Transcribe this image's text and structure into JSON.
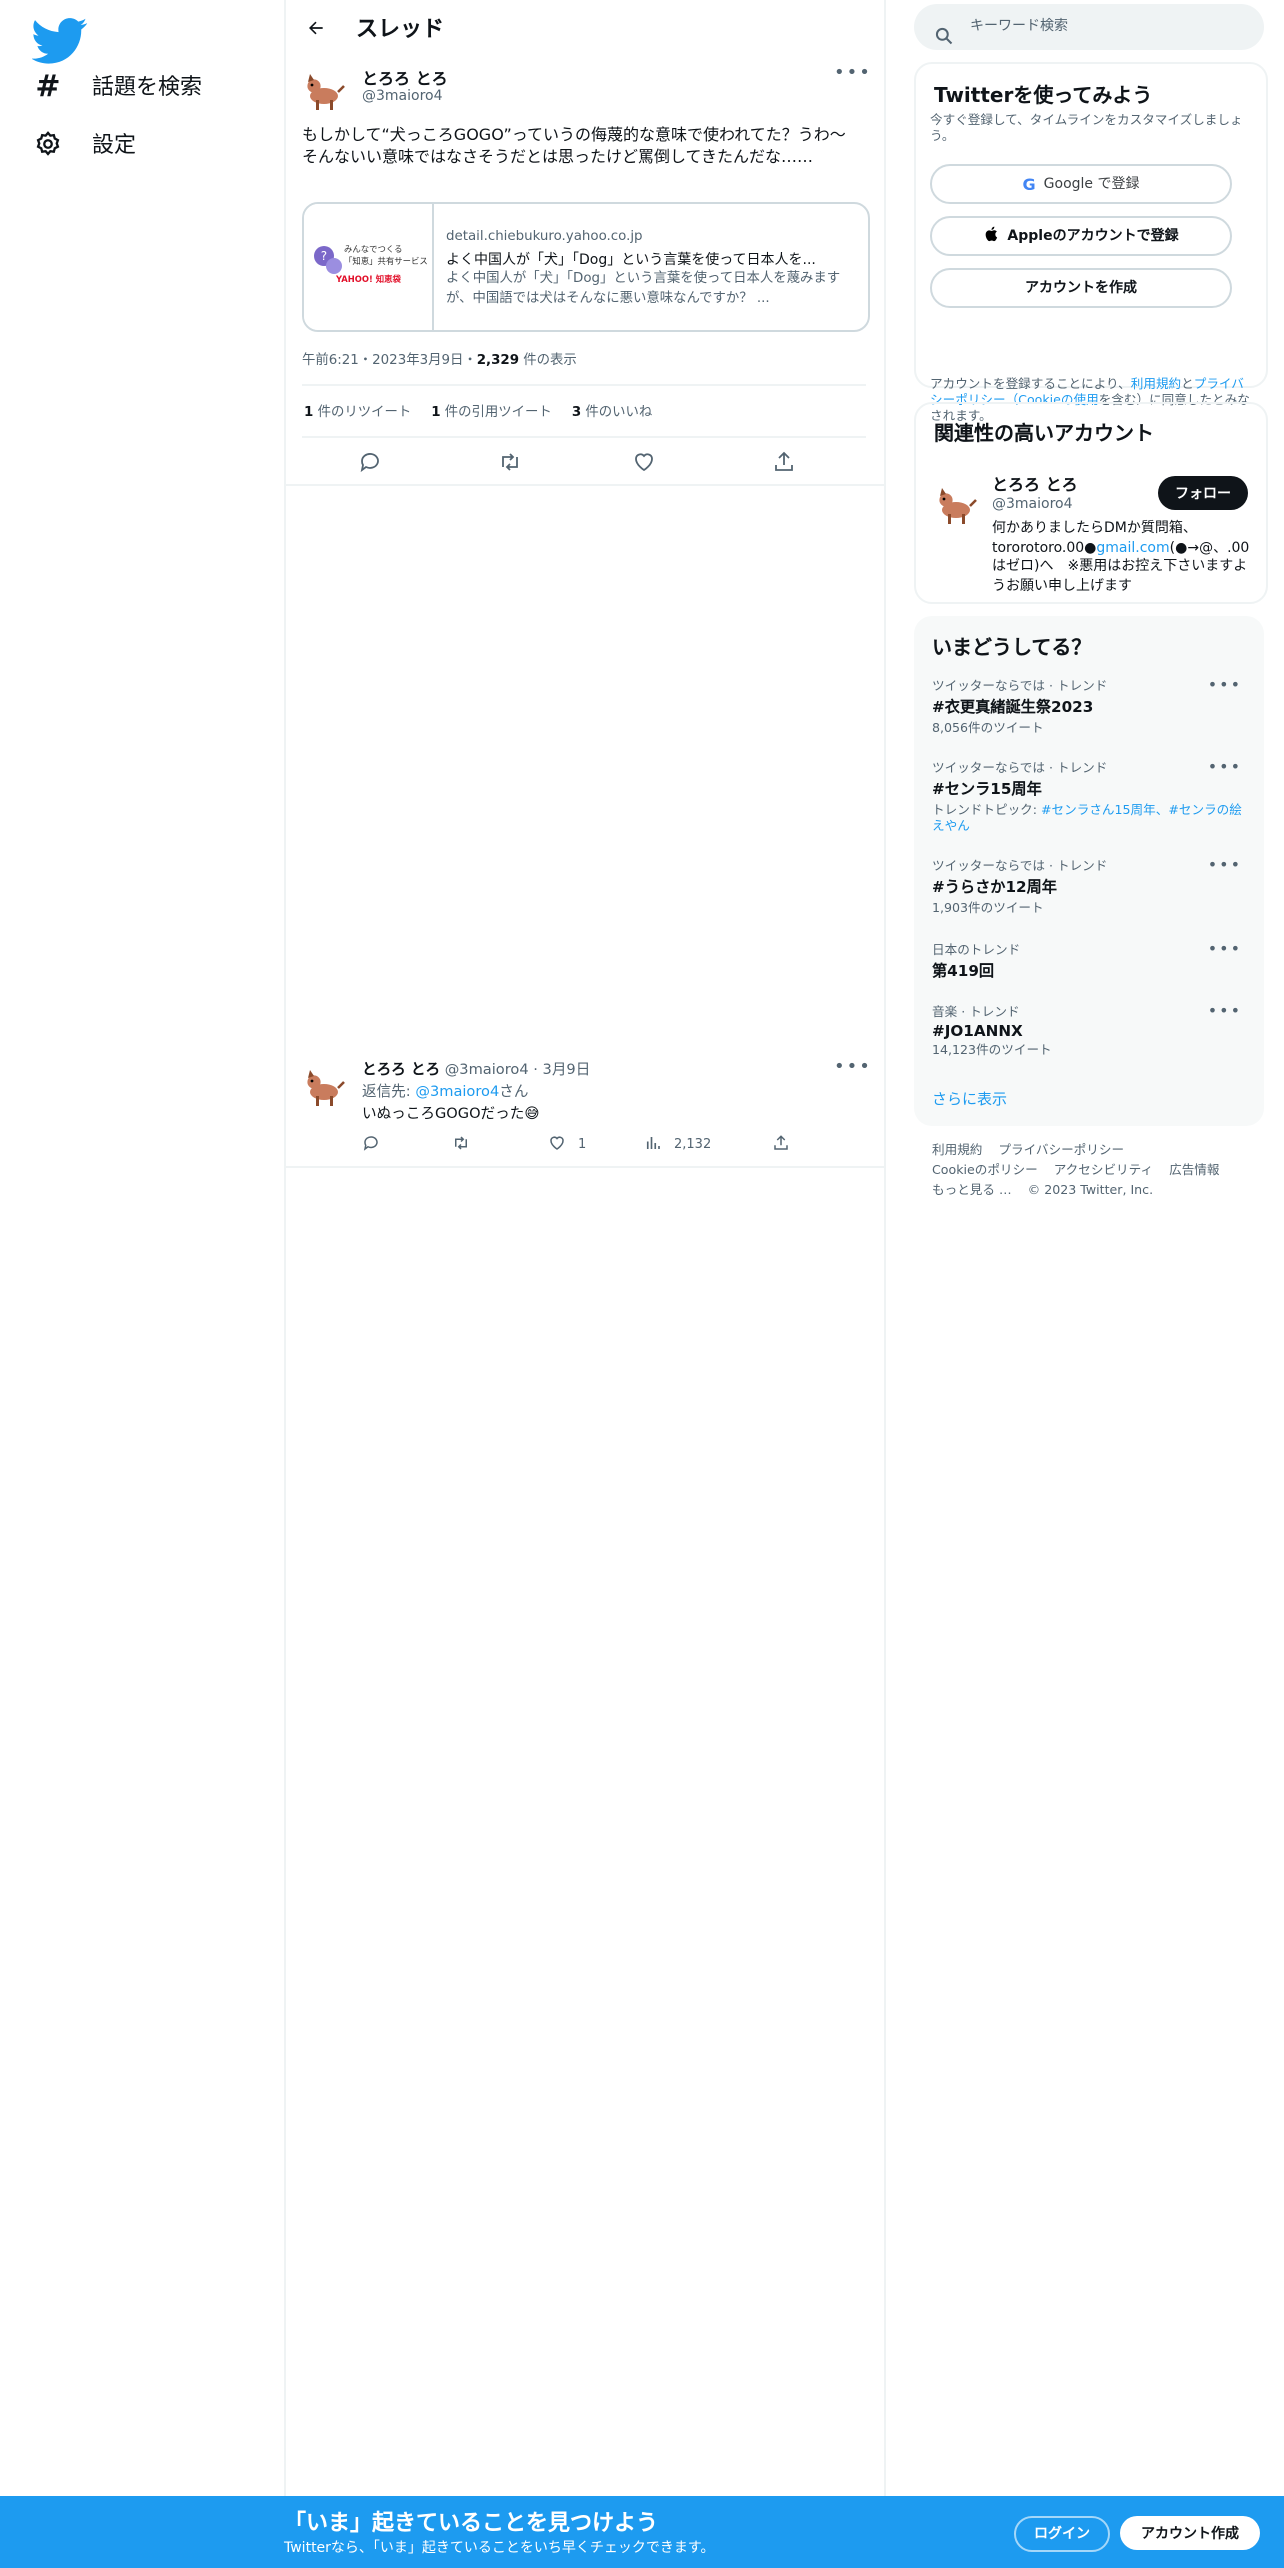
{
  "nav": {
    "items": [
      {
        "label": "話題を検索",
        "icon": "hashtag-icon"
      },
      {
        "label": "設定",
        "icon": "gear-icon"
      }
    ]
  },
  "thread": {
    "title": "スレッド"
  },
  "tweet1": {
    "name": "とろろ とろ",
    "handle": "@3maioro4",
    "text_line1": "もしかして“犬っころGOGO”っていうの侮蔑的な意味で使われてた？うわ～",
    "text_line2": "そんないい意味ではなさそうだとは思ったけど罵倒してきたんだな……",
    "card": {
      "image_text": [
        "みんなでつくる",
        "「知恵」共有サービス",
        "YAHOO! 知恵袋"
      ],
      "domain": "detail.chiebukuro.yahoo.co.jp",
      "title": "よく中国人が「犬」「Dog」という言葉を使って日本人を...",
      "description": "よく中国人が「犬」「Dog」という言葉を使って日本人を蔑みますが、中国語では犬はそんなに悪い意味なんですか？ ..."
    },
    "meta_prefix": "午前6:21・2023年3月9日・",
    "views": "2,329",
    "views_suffix": " 件の表示",
    "stats": [
      {
        "count": "1",
        "label": " 件のリツイート"
      },
      {
        "count": "1",
        "label": " 件の引用ツイート"
      },
      {
        "count": "3",
        "label": " 件のいいね"
      }
    ]
  },
  "tweet2": {
    "name": "とろろ とろ",
    "handle_date": " @3maioro4 · 3月9日",
    "reply_prefix": "返信先: ",
    "reply_to": "@3maioro4",
    "reply_suffix": "さん",
    "text": "いぬっころGOGOだった😅",
    "likes": "1",
    "views": "2,132"
  },
  "search": {
    "placeholder": "キーワード検索"
  },
  "signup": {
    "title": "Twitterを使ってみよう",
    "subtitle": "今すぐ登録して、タイムラインをカスタマイズしましょう。",
    "google": "Google で登録",
    "apple": "Appleのアカウントで登録",
    "create": "アカウントを作成",
    "legal_1": "アカウントを登録することにより、",
    "legal_terms": "利用規約",
    "legal_2": "と",
    "legal_privacy": "プライバシーポリシー（Cookieの使用",
    "legal_3": "を含む）に同意したとみなされます。"
  },
  "related": {
    "title": "関連性の高いアカウント",
    "name": "とろろ とろ",
    "handle": "@3maioro4",
    "follow": "フォロー",
    "bio_1": "何かありましたらDMか質問箱、tororotoro.00●",
    "bio_link": "gmail.com",
    "bio_2": "(●→@、.00はゼロ)へ　※悪用はお控え下さいますようお願い申し上げます"
  },
  "trends": {
    "title": "いまどうしてる？",
    "items": [
      {
        "context": "ツイッターならでは · トレンド",
        "name": "#衣更真緒誕生祭2023",
        "count": "8,056件のツイート"
      },
      {
        "context": "ツイッターならでは · トレンド",
        "name": "#センラ15周年",
        "topic_prefix": "トレンドトピック: ",
        "topic_links": "#センラさん15周年、#センラの絵えやん"
      },
      {
        "context": "ツイッターならでは · トレンド",
        "name": "#うらさか12周年",
        "count": "1,903件のツイート"
      },
      {
        "context": "日本のトレンド",
        "name": "第419回",
        "count": ""
      },
      {
        "context": "音楽 · トレンド",
        "name": "#JO1ANNX",
        "count": "14,123件のツイート"
      }
    ],
    "show_more": "さらに表示"
  },
  "footer": {
    "links": [
      "利用規約",
      "プライバシーポリシー",
      "Cookieのポリシー",
      "アクセシビリティ",
      "広告情報",
      "もっと見る …",
      "© 2023 Twitter, Inc."
    ]
  },
  "bottom_bar": {
    "title": "「いま」起きていることを見つけよう",
    "subtitle": "Twitterなら、「いま」起きていることをいち早くチェックできます。",
    "login": "ログイン",
    "signup": "アカウント作成"
  },
  "colors": {
    "brand": "#1d9bf0",
    "text": "#0f1419",
    "secondary": "#536471"
  }
}
